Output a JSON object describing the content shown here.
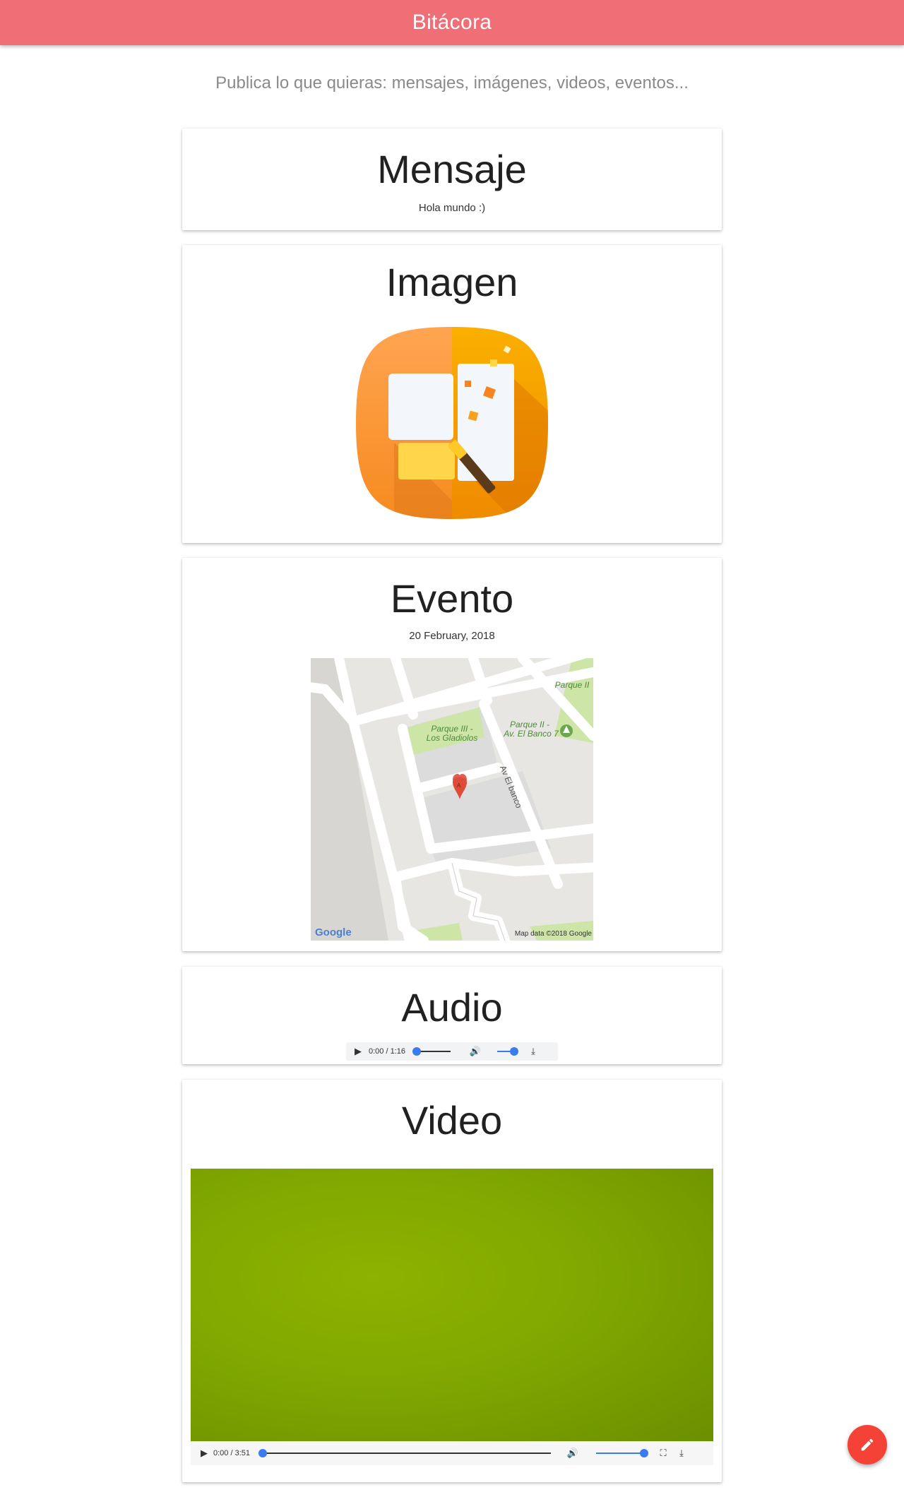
{
  "app": {
    "title": "Bitácora"
  },
  "intro": "Publica lo que quieras: mensajes, imágenes, videos, eventos...",
  "cards": {
    "mensaje": {
      "title": "Mensaje",
      "text": "Hola mundo :)"
    },
    "imagen": {
      "title": "Imagen",
      "image_icon": "photo-editor-app-icon"
    },
    "evento": {
      "title": "Evento",
      "date": "20 February, 2018",
      "map": {
        "labels": {
          "park_a": "Parque III -",
          "park_a2": "Los Gladiolos",
          "park_b": "Parque II -",
          "park_b2": "Av. El Banco 7",
          "park_c": "Parque II",
          "road": "Av El banco",
          "marker": "A"
        },
        "logo": "Google",
        "attribution": "Map data ©2018 Google"
      }
    },
    "audio": {
      "title": "Audio",
      "time": "0:00 / 1:16",
      "progress": 0,
      "volume": 1
    },
    "video": {
      "title": "Video",
      "time": "0:00 / 3:51",
      "progress": 0,
      "volume": 1
    }
  },
  "fab": {
    "icon": "pencil-icon",
    "color": "#f44336"
  },
  "colors": {
    "appbar": "#f06e75",
    "accent": "#3b7bf0"
  }
}
